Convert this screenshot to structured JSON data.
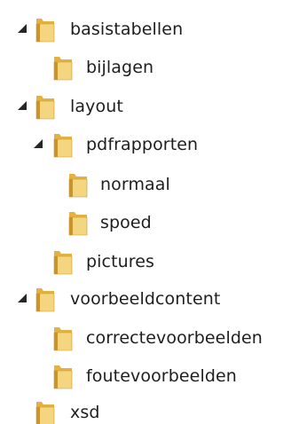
{
  "tree": {
    "items": [
      {
        "label": "basistabellen",
        "level": 0,
        "expanded": true,
        "icon": "folder-icon"
      },
      {
        "label": "bijlagen",
        "level": 1,
        "expanded": false,
        "icon": "folder-icon"
      },
      {
        "label": "layout",
        "level": 0,
        "expanded": true,
        "icon": "folder-icon"
      },
      {
        "label": "pdfrapporten",
        "level": 1,
        "expanded": true,
        "icon": "folder-icon"
      },
      {
        "label": "normaal",
        "level": 2,
        "expanded": false,
        "icon": "folder-icon"
      },
      {
        "label": "spoed",
        "level": 2,
        "expanded": false,
        "icon": "folder-icon"
      },
      {
        "label": "pictures",
        "level": 1,
        "expanded": false,
        "icon": "folder-icon"
      },
      {
        "label": "voorbeeldcontent",
        "level": 0,
        "expanded": true,
        "icon": "folder-icon"
      },
      {
        "label": "correctevoorbeelden",
        "level": 1,
        "expanded": false,
        "icon": "folder-icon"
      },
      {
        "label": "foutevoorbeelden",
        "level": 1,
        "expanded": false,
        "icon": "folder-icon"
      },
      {
        "label": "xsd",
        "level": 0,
        "expanded": false,
        "icon": "folder-icon"
      }
    ],
    "colors": {
      "folder_back": "#e3b241",
      "folder_front": "#f4d680",
      "folder_edge": "#c9952a",
      "text": "#1e1e1e",
      "arrow": "#262626"
    }
  }
}
